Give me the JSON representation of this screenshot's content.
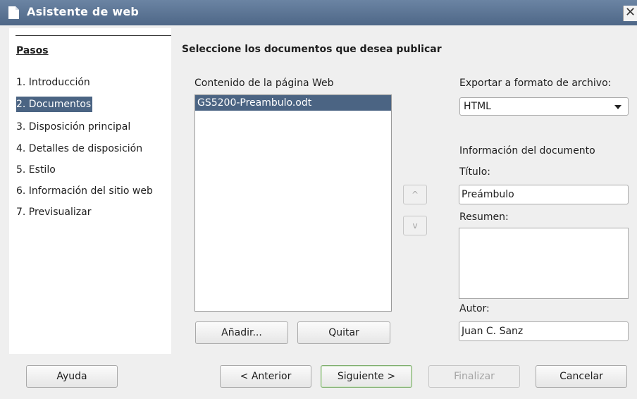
{
  "window": {
    "title": "Asistente de web",
    "close_glyph": "✕"
  },
  "sidebar": {
    "title": "Pasos",
    "steps": [
      {
        "label": "1. Introducción"
      },
      {
        "label": "2. Documentos",
        "active": true
      },
      {
        "label": "3. Disposición principal"
      },
      {
        "label": "4. Detalles de disposición"
      },
      {
        "label": "5. Estilo"
      },
      {
        "label": "6. Información del sitio web"
      },
      {
        "label": "7. Previsualizar"
      }
    ]
  },
  "main": {
    "heading": "Seleccione los documentos que desea publicar",
    "content_label": "Contenido de la página Web",
    "documents": [
      {
        "name": "GS5200-Preambulo.odt",
        "selected": true
      }
    ],
    "add_button": "Añadir...",
    "remove_button": "Quitar",
    "move_up_glyph": "^",
    "move_down_glyph": "v",
    "export_label": "Exportar a formato de archivo:",
    "export_value": "HTML",
    "doc_info_label": "Información del documento",
    "title_label": "Título:",
    "title_value": "Preámbulo",
    "summary_label": "Resumen:",
    "summary_value": "",
    "author_label": "Autor:",
    "author_value": "Juan C. Sanz"
  },
  "footer": {
    "help": "Ayuda",
    "previous": "< Anterior",
    "next": "Siguiente >",
    "finish": "Finalizar",
    "cancel": "Cancelar"
  },
  "colors": {
    "titlebar": "#4e6787",
    "selection": "#4b6483",
    "default_button_border": "#7fae6e"
  }
}
